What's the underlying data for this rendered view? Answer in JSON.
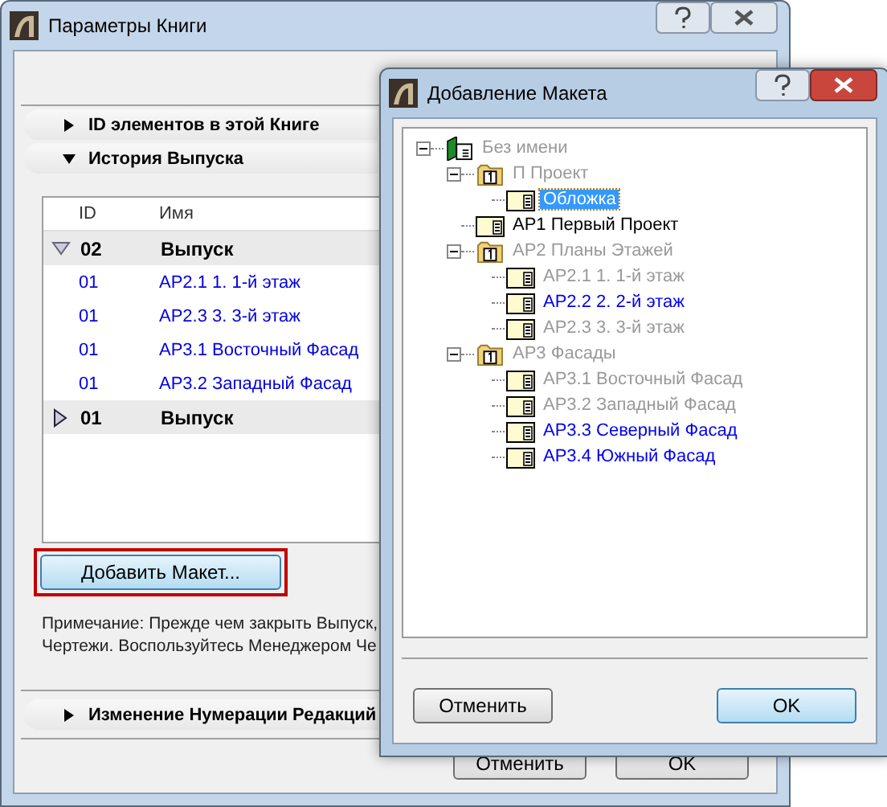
{
  "main_window": {
    "title": "Параметры Книги",
    "sections": [
      {
        "label": "ID элементов в этой Книге",
        "expanded": false
      },
      {
        "label": "История Выпуска",
        "expanded": true
      }
    ],
    "table": {
      "columns": [
        "ID",
        "Имя"
      ],
      "rows": [
        {
          "kind": "release",
          "expanded": true,
          "id": "02",
          "name": "Выпуск"
        },
        {
          "kind": "layout",
          "id": "01",
          "name": "АР2.1 1. 1-й этаж"
        },
        {
          "kind": "layout",
          "id": "01",
          "name": "АР2.3 3. 3-й этаж"
        },
        {
          "kind": "layout",
          "id": "01",
          "name": "АР3.1 Восточный Фасад"
        },
        {
          "kind": "layout",
          "id": "01",
          "name": "АР3.2 Западный Фасад"
        },
        {
          "kind": "release",
          "expanded": false,
          "id": "01",
          "name": "Выпуск"
        }
      ]
    },
    "add_button": "Добавить Макет...",
    "note": [
      "Примечание: Прежде чем закрыть Выпуск,",
      "Чертежи. Воспользуйтесь Менеджером Че"
    ],
    "bottom_section": {
      "label": "Изменение Нумерации Редакций",
      "expanded": false
    },
    "buttons": [
      "Отменить",
      "OK"
    ]
  },
  "dialog": {
    "title": "Добавление Макета",
    "tree": [
      {
        "kind": "book",
        "label": "Без имени",
        "disabled": true,
        "added": false,
        "selected": false,
        "expanded": true,
        "children": [
          {
            "kind": "folder",
            "label": "П Проект",
            "disabled": true,
            "added": false,
            "selected": false,
            "expanded": true,
            "children": [
              {
                "kind": "layout",
                "label": "Обложка",
                "disabled": false,
                "added": false,
                "selected": true
              }
            ]
          },
          {
            "kind": "layout",
            "label": "АР1 Первый Проект",
            "disabled": false,
            "added": false,
            "selected": false
          },
          {
            "kind": "folder",
            "label": "АР2 Планы Этажей",
            "disabled": true,
            "added": false,
            "selected": false,
            "expanded": true,
            "children": [
              {
                "kind": "layout",
                "label": "АР2.1 1. 1-й этаж",
                "disabled": true,
                "added": false,
                "selected": false
              },
              {
                "kind": "layout",
                "label": "АР2.2 2. 2-й этаж",
                "disabled": false,
                "added": true,
                "selected": false
              },
              {
                "kind": "layout",
                "label": "АР2.3 3. 3-й этаж",
                "disabled": true,
                "added": false,
                "selected": false
              }
            ]
          },
          {
            "kind": "folder",
            "label": "АР3 Фасады",
            "disabled": true,
            "added": false,
            "selected": false,
            "expanded": true,
            "children": [
              {
                "kind": "layout",
                "label": "АР3.1 Восточный Фасад",
                "disabled": true,
                "added": false,
                "selected": false
              },
              {
                "kind": "layout",
                "label": "АР3.2 Западный Фасад",
                "disabled": true,
                "added": false,
                "selected": false
              },
              {
                "kind": "layout",
                "label": "АР3.3 Северный Фасад",
                "disabled": false,
                "added": true,
                "selected": false
              },
              {
                "kind": "layout",
                "label": "АР3.4 Южный Фасад",
                "disabled": false,
                "added": true,
                "selected": false
              }
            ]
          }
        ]
      }
    ],
    "buttons": [
      {
        "label": "Отменить",
        "default": false
      },
      {
        "label": "OK",
        "default": true
      }
    ]
  }
}
